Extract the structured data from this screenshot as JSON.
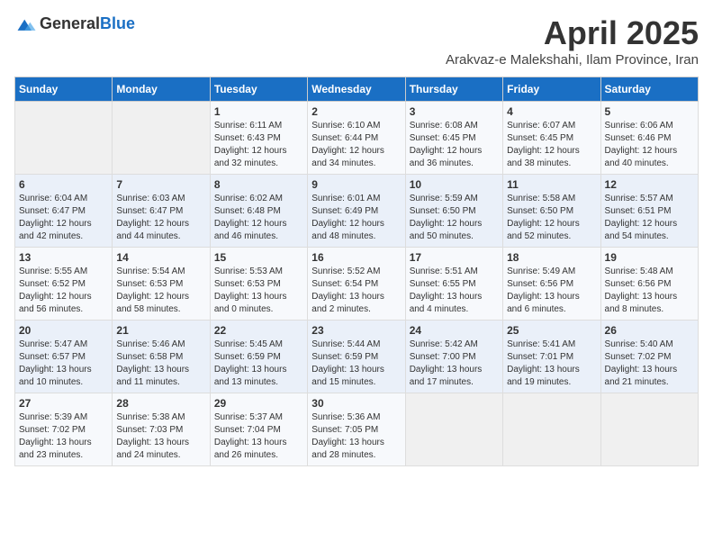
{
  "logo": {
    "text_general": "General",
    "text_blue": "Blue"
  },
  "header": {
    "month_title": "April 2025",
    "location": "Arakvaz-e Malekshahi, Ilam Province, Iran"
  },
  "weekdays": [
    "Sunday",
    "Monday",
    "Tuesday",
    "Wednesday",
    "Thursday",
    "Friday",
    "Saturday"
  ],
  "weeks": [
    [
      {
        "day": "",
        "info": ""
      },
      {
        "day": "",
        "info": ""
      },
      {
        "day": "1",
        "info": "Sunrise: 6:11 AM\nSunset: 6:43 PM\nDaylight: 12 hours\nand 32 minutes."
      },
      {
        "day": "2",
        "info": "Sunrise: 6:10 AM\nSunset: 6:44 PM\nDaylight: 12 hours\nand 34 minutes."
      },
      {
        "day": "3",
        "info": "Sunrise: 6:08 AM\nSunset: 6:45 PM\nDaylight: 12 hours\nand 36 minutes."
      },
      {
        "day": "4",
        "info": "Sunrise: 6:07 AM\nSunset: 6:45 PM\nDaylight: 12 hours\nand 38 minutes."
      },
      {
        "day": "5",
        "info": "Sunrise: 6:06 AM\nSunset: 6:46 PM\nDaylight: 12 hours\nand 40 minutes."
      }
    ],
    [
      {
        "day": "6",
        "info": "Sunrise: 6:04 AM\nSunset: 6:47 PM\nDaylight: 12 hours\nand 42 minutes."
      },
      {
        "day": "7",
        "info": "Sunrise: 6:03 AM\nSunset: 6:47 PM\nDaylight: 12 hours\nand 44 minutes."
      },
      {
        "day": "8",
        "info": "Sunrise: 6:02 AM\nSunset: 6:48 PM\nDaylight: 12 hours\nand 46 minutes."
      },
      {
        "day": "9",
        "info": "Sunrise: 6:01 AM\nSunset: 6:49 PM\nDaylight: 12 hours\nand 48 minutes."
      },
      {
        "day": "10",
        "info": "Sunrise: 5:59 AM\nSunset: 6:50 PM\nDaylight: 12 hours\nand 50 minutes."
      },
      {
        "day": "11",
        "info": "Sunrise: 5:58 AM\nSunset: 6:50 PM\nDaylight: 12 hours\nand 52 minutes."
      },
      {
        "day": "12",
        "info": "Sunrise: 5:57 AM\nSunset: 6:51 PM\nDaylight: 12 hours\nand 54 minutes."
      }
    ],
    [
      {
        "day": "13",
        "info": "Sunrise: 5:55 AM\nSunset: 6:52 PM\nDaylight: 12 hours\nand 56 minutes."
      },
      {
        "day": "14",
        "info": "Sunrise: 5:54 AM\nSunset: 6:53 PM\nDaylight: 12 hours\nand 58 minutes."
      },
      {
        "day": "15",
        "info": "Sunrise: 5:53 AM\nSunset: 6:53 PM\nDaylight: 13 hours\nand 0 minutes."
      },
      {
        "day": "16",
        "info": "Sunrise: 5:52 AM\nSunset: 6:54 PM\nDaylight: 13 hours\nand 2 minutes."
      },
      {
        "day": "17",
        "info": "Sunrise: 5:51 AM\nSunset: 6:55 PM\nDaylight: 13 hours\nand 4 minutes."
      },
      {
        "day": "18",
        "info": "Sunrise: 5:49 AM\nSunset: 6:56 PM\nDaylight: 13 hours\nand 6 minutes."
      },
      {
        "day": "19",
        "info": "Sunrise: 5:48 AM\nSunset: 6:56 PM\nDaylight: 13 hours\nand 8 minutes."
      }
    ],
    [
      {
        "day": "20",
        "info": "Sunrise: 5:47 AM\nSunset: 6:57 PM\nDaylight: 13 hours\nand 10 minutes."
      },
      {
        "day": "21",
        "info": "Sunrise: 5:46 AM\nSunset: 6:58 PM\nDaylight: 13 hours\nand 11 minutes."
      },
      {
        "day": "22",
        "info": "Sunrise: 5:45 AM\nSunset: 6:59 PM\nDaylight: 13 hours\nand 13 minutes."
      },
      {
        "day": "23",
        "info": "Sunrise: 5:44 AM\nSunset: 6:59 PM\nDaylight: 13 hours\nand 15 minutes."
      },
      {
        "day": "24",
        "info": "Sunrise: 5:42 AM\nSunset: 7:00 PM\nDaylight: 13 hours\nand 17 minutes."
      },
      {
        "day": "25",
        "info": "Sunrise: 5:41 AM\nSunset: 7:01 PM\nDaylight: 13 hours\nand 19 minutes."
      },
      {
        "day": "26",
        "info": "Sunrise: 5:40 AM\nSunset: 7:02 PM\nDaylight: 13 hours\nand 21 minutes."
      }
    ],
    [
      {
        "day": "27",
        "info": "Sunrise: 5:39 AM\nSunset: 7:02 PM\nDaylight: 13 hours\nand 23 minutes."
      },
      {
        "day": "28",
        "info": "Sunrise: 5:38 AM\nSunset: 7:03 PM\nDaylight: 13 hours\nand 24 minutes."
      },
      {
        "day": "29",
        "info": "Sunrise: 5:37 AM\nSunset: 7:04 PM\nDaylight: 13 hours\nand 26 minutes."
      },
      {
        "day": "30",
        "info": "Sunrise: 5:36 AM\nSunset: 7:05 PM\nDaylight: 13 hours\nand 28 minutes."
      },
      {
        "day": "",
        "info": ""
      },
      {
        "day": "",
        "info": ""
      },
      {
        "day": "",
        "info": ""
      }
    ]
  ]
}
